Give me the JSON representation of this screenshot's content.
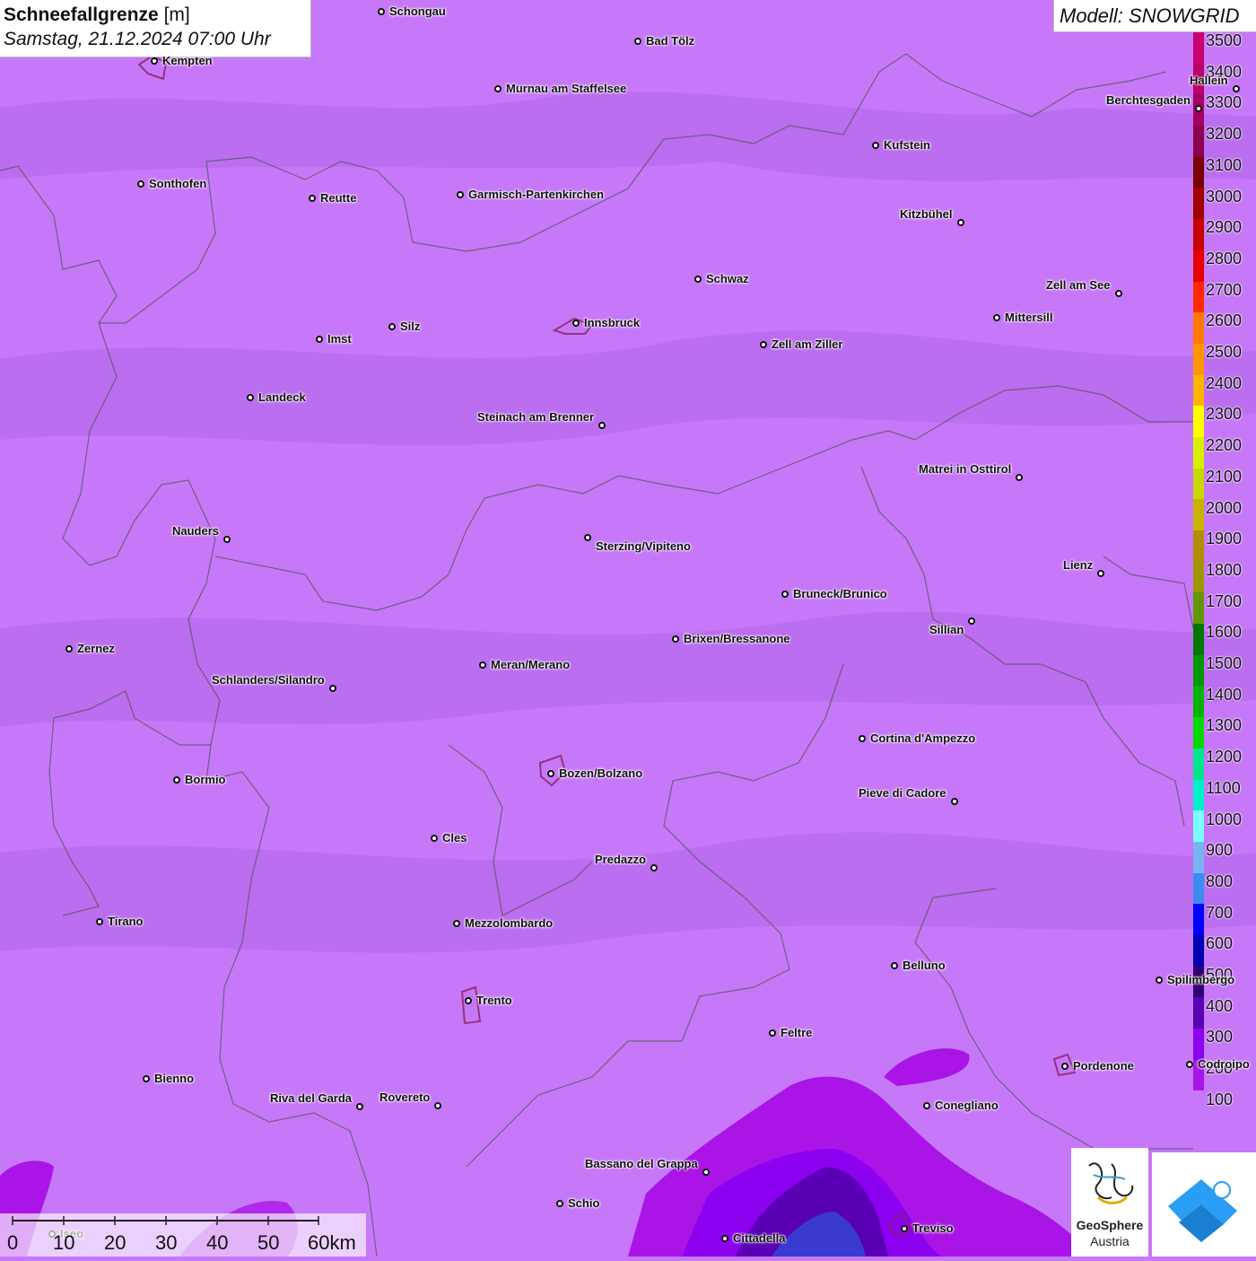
{
  "title": {
    "parameter": "Schneefallgrenze",
    "unit": "[m]",
    "datetime": "Samstag, 21.12.2024 07:00 Uhr"
  },
  "model": {
    "label": "Modell: SNOWGRID"
  },
  "legend": {
    "entries": [
      {
        "value": "3500",
        "color": "#c8006e"
      },
      {
        "value": "3400",
        "color": "#b80068"
      },
      {
        "value": "3300",
        "color": "#a40060"
      },
      {
        "value": "3200",
        "color": "#8c0050"
      },
      {
        "value": "3100",
        "color": "#780000"
      },
      {
        "value": "3000",
        "color": "#a00000"
      },
      {
        "value": "2900",
        "color": "#c80000"
      },
      {
        "value": "2800",
        "color": "#e60000"
      },
      {
        "value": "2700",
        "color": "#ff2800"
      },
      {
        "value": "2600",
        "color": "#ff7800"
      },
      {
        "value": "2500",
        "color": "#ff9600"
      },
      {
        "value": "2400",
        "color": "#ffb400"
      },
      {
        "value": "2300",
        "color": "#ffff00"
      },
      {
        "value": "2200",
        "color": "#d8f000"
      },
      {
        "value": "2100",
        "color": "#c8d800"
      },
      {
        "value": "2000",
        "color": "#c8b400"
      },
      {
        "value": "1900",
        "color": "#b48c00"
      },
      {
        "value": "1800",
        "color": "#a09600"
      },
      {
        "value": "1700",
        "color": "#649600"
      },
      {
        "value": "1600",
        "color": "#007800"
      },
      {
        "value": "1500",
        "color": "#009600"
      },
      {
        "value": "1400",
        "color": "#00b400"
      },
      {
        "value": "1300",
        "color": "#00d800"
      },
      {
        "value": "1200",
        "color": "#00e68c"
      },
      {
        "value": "1100",
        "color": "#00f0c8"
      },
      {
        "value": "1000",
        "color": "#78ffff"
      },
      {
        "value": "900",
        "color": "#78b4f0"
      },
      {
        "value": "800",
        "color": "#3c8cf0"
      },
      {
        "value": "700",
        "color": "#0000ff"
      },
      {
        "value": "600",
        "color": "#0000b4"
      },
      {
        "value": "500",
        "color": "#32006e"
      },
      {
        "value": "400",
        "color": "#5a00b4"
      },
      {
        "value": "300",
        "color": "#8c00f0"
      },
      {
        "value": "200",
        "color": "#aa14e6"
      },
      {
        "value": "100",
        "color": "#c678f8"
      }
    ]
  },
  "cities": [
    {
      "name": "Schongau"
    },
    {
      "name": "Bad Tölz"
    },
    {
      "name": "Kempten"
    },
    {
      "name": "Murnau am Staffelsee"
    },
    {
      "name": "Hallein"
    },
    {
      "name": "Berchtesgaden"
    },
    {
      "name": "Kufstein"
    },
    {
      "name": "Sonthofen"
    },
    {
      "name": "Reutte"
    },
    {
      "name": "Garmisch-Partenkirchen"
    },
    {
      "name": "Kitzbühel"
    },
    {
      "name": "Schwaz"
    },
    {
      "name": "Zell am See"
    },
    {
      "name": "Mittersill"
    },
    {
      "name": "Innsbruck"
    },
    {
      "name": "Imst"
    },
    {
      "name": "Silz"
    },
    {
      "name": "Zell am Ziller"
    },
    {
      "name": "Landeck"
    },
    {
      "name": "Steinach am Brenner"
    },
    {
      "name": "Matrei in Osttirol"
    },
    {
      "name": "Nauders"
    },
    {
      "name": "Sterzing/Vipiteno"
    },
    {
      "name": "Lienz"
    },
    {
      "name": "Bruneck/Brunico"
    },
    {
      "name": "Sillian"
    },
    {
      "name": "Zernez"
    },
    {
      "name": "Brixen/Bressanone"
    },
    {
      "name": "Meran/Merano"
    },
    {
      "name": "Schlanders/Silandro"
    },
    {
      "name": "Cortina d'Ampezzo"
    },
    {
      "name": "Bozen/Bolzano"
    },
    {
      "name": "Bormio"
    },
    {
      "name": "Pieve di Cadore"
    },
    {
      "name": "Cles"
    },
    {
      "name": "Predazzo"
    },
    {
      "name": "Tirano"
    },
    {
      "name": "Mezzolombardo"
    },
    {
      "name": "Belluno"
    },
    {
      "name": "Spilimbergo"
    },
    {
      "name": "Trento"
    },
    {
      "name": "Feltre"
    },
    {
      "name": "Pordenone"
    },
    {
      "name": "Codroipo"
    },
    {
      "name": "Bienno"
    },
    {
      "name": "Riva del Garda"
    },
    {
      "name": "Rovereto"
    },
    {
      "name": "Conegliano"
    },
    {
      "name": "Bassano del Grappa"
    },
    {
      "name": "Schio"
    },
    {
      "name": "Treviso"
    },
    {
      "name": "Cittadella"
    },
    {
      "name": "Iseo"
    }
  ],
  "scale": {
    "ticks": [
      "0",
      "10",
      "20",
      "30",
      "40",
      "50",
      "60km"
    ]
  },
  "logos": {
    "geosphere_line1": "GeoSphere",
    "geosphere_line2": "Austria"
  }
}
